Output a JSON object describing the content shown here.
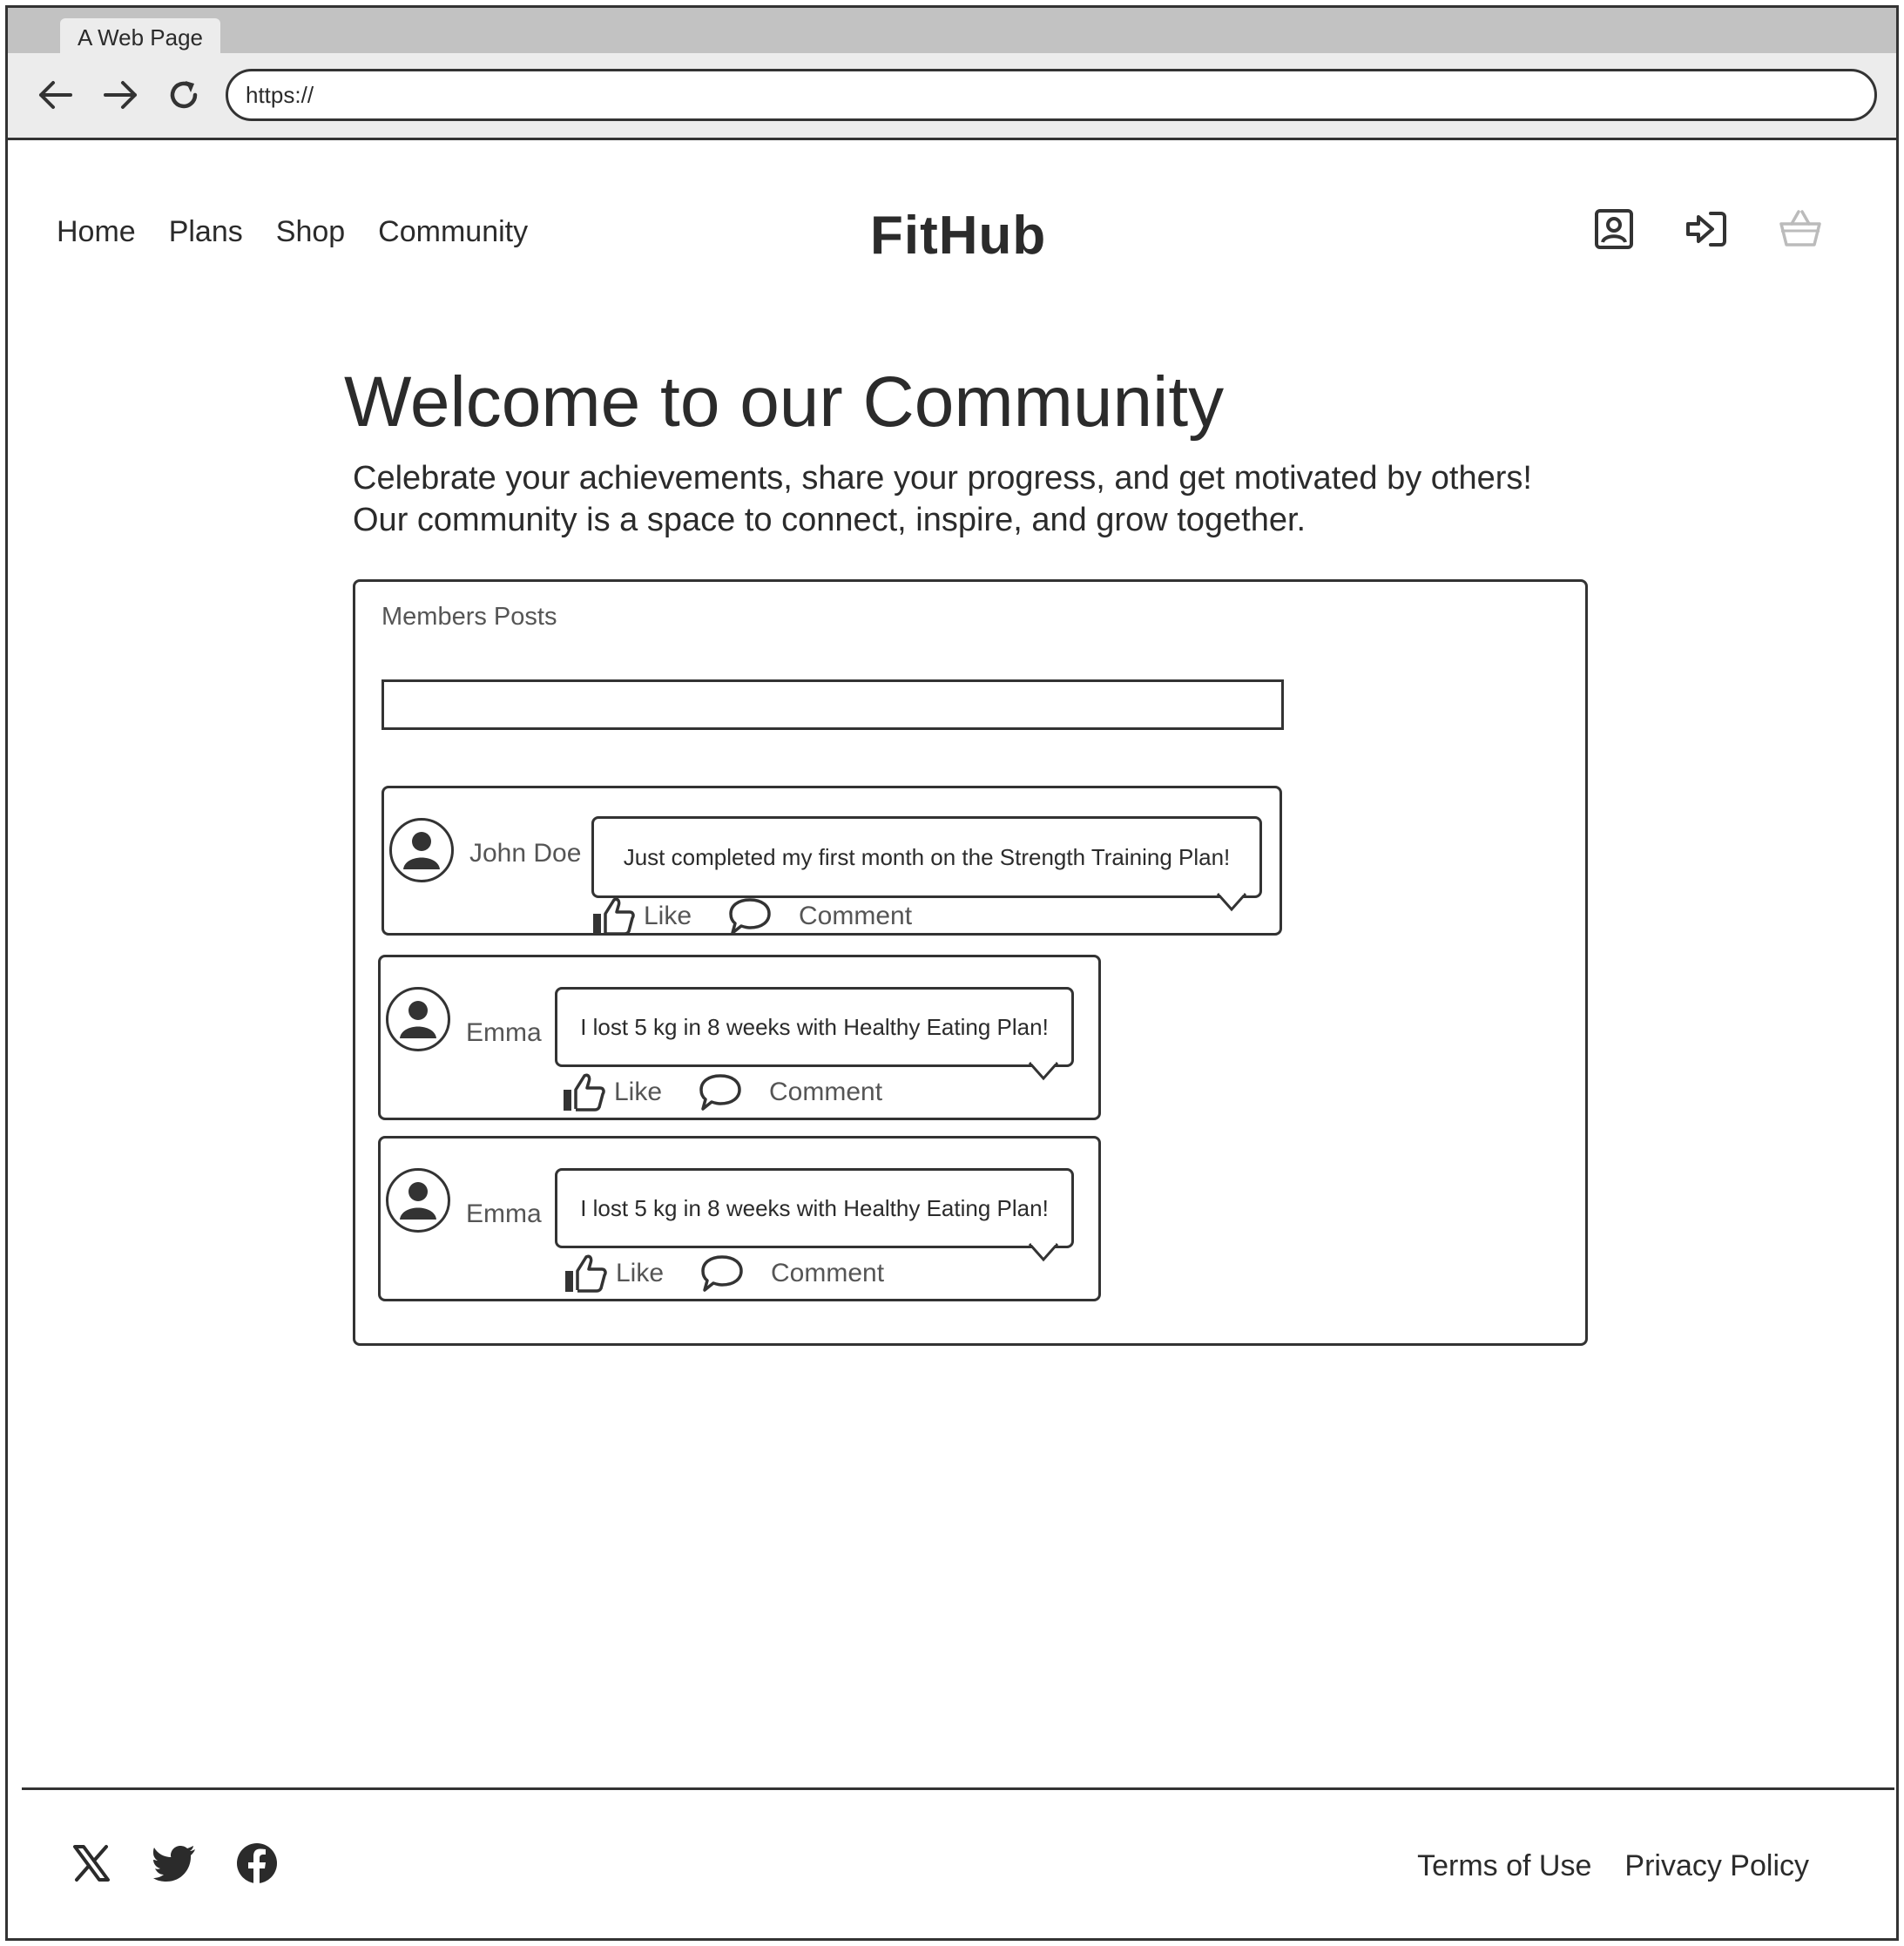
{
  "browser": {
    "tab_title": "A Web Page",
    "url": "https://"
  },
  "header": {
    "nav": [
      "Home",
      "Plans",
      "Shop",
      "Community"
    ],
    "logo": "FitHub",
    "icons": [
      "user-profile-icon",
      "sign-in-icon",
      "shopping-basket-icon"
    ]
  },
  "hero": {
    "title": "Welcome to our Community",
    "subtitle_line1": "Celebrate your achievements, share your progress, and get motivated by others!",
    "subtitle_line2": "Our community is a space to connect, inspire, and grow together."
  },
  "posts_panel": {
    "label": "Members Posts",
    "input_value": "",
    "like_label": "Like",
    "comment_label": "Comment",
    "posts": [
      {
        "author": "John Doe",
        "text": "Just completed my first month on the Strength Training Plan!"
      },
      {
        "author": "Emma",
        "text": "I lost 5 kg in 8 weeks with Healthy Eating Plan!"
      },
      {
        "author": "Emma",
        "text": "I lost 5 kg in 8 weeks with Healthy Eating Plan!"
      }
    ]
  },
  "footer": {
    "social": [
      "x-icon",
      "twitter-icon",
      "facebook-icon"
    ],
    "links": [
      "Terms of Use",
      "Privacy Policy"
    ]
  }
}
